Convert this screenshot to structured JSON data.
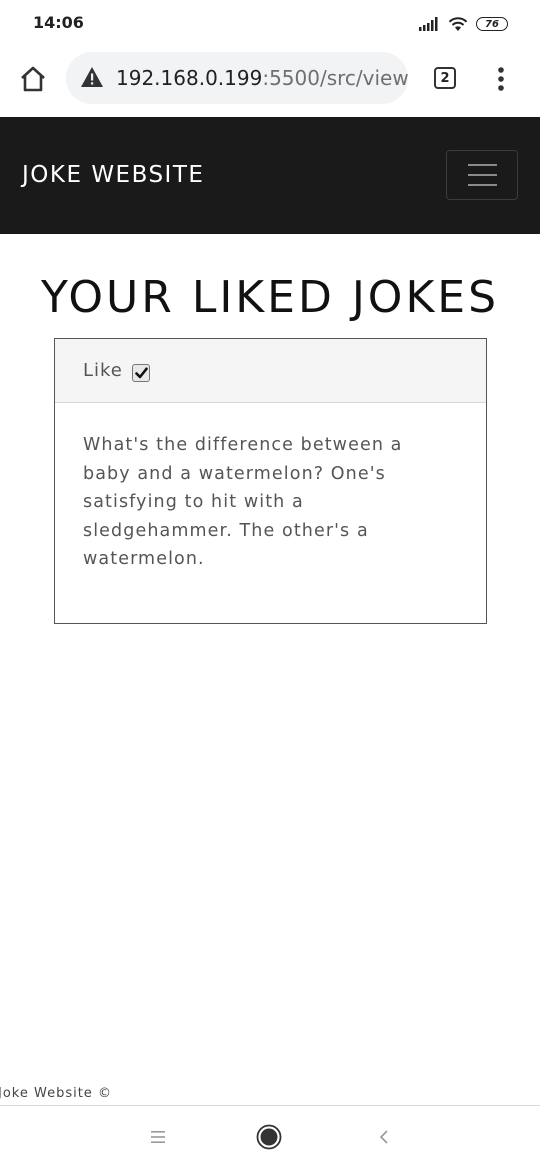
{
  "status_bar": {
    "time": "14:06",
    "battery": "76",
    "icons": [
      "signal-icon",
      "wifi-icon",
      "battery-icon"
    ]
  },
  "browser": {
    "url_host": "192.168.0.199",
    "url_path": ":5500/src/view",
    "tab_count": "2",
    "icons": [
      "home-icon",
      "warning-icon",
      "more-vert-icon"
    ]
  },
  "navbar": {
    "brand": "JOKE WEBSITE",
    "background": "#1a1a1a",
    "icons": [
      "hamburger-icon"
    ]
  },
  "main": {
    "title": "YOUR LIKED JOKES",
    "jokes": [
      {
        "like_label": "Like",
        "liked": true,
        "text": "What's the difference between a baby and a watermelon? One's satisfying to hit with a sledgehammer. The other's a watermelon."
      }
    ]
  },
  "footer": {
    "text": "Joke Website ©"
  },
  "system_nav": {
    "icons": [
      "recents-icon",
      "home-circle-icon",
      "back-icon"
    ]
  }
}
